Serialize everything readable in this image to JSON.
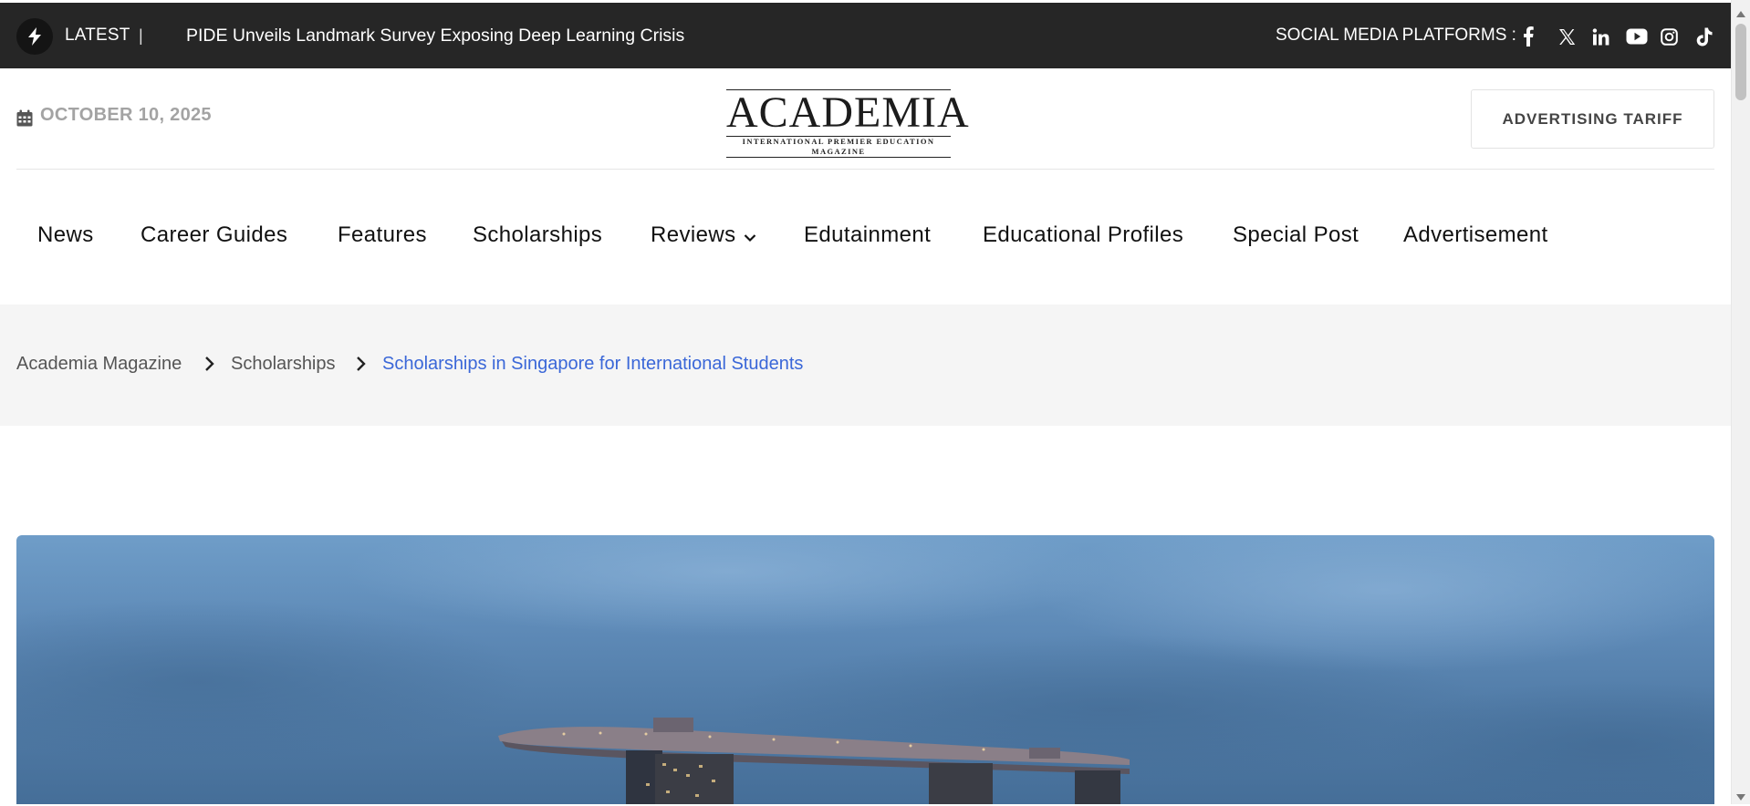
{
  "topbar": {
    "latest_label": "LATEST",
    "separator": "|",
    "headline": "PIDE Unveils Landmark Survey Exposing Deep Learning Crisis",
    "social_label": "SOCIAL MEDIA PLATFORMS :",
    "social_icons": [
      "facebook-icon",
      "x-icon",
      "linkedin-icon",
      "youtube-icon",
      "instagram-icon",
      "tiktok-icon"
    ]
  },
  "header": {
    "date": "OCTOBER 10, 2025",
    "logo_name": "ACADEMIA",
    "logo_tagline": "INTERNATIONAL PREMIER EDUCATION MAGAZINE",
    "advertising_button": "ADVERTISING TARIFF"
  },
  "nav": {
    "items": [
      {
        "label": "News"
      },
      {
        "label": "Career Guides"
      },
      {
        "label": "Features"
      },
      {
        "label": "Scholarships"
      },
      {
        "label": "Reviews"
      },
      {
        "label": "Edutainment"
      },
      {
        "label": "Educational Profiles"
      },
      {
        "label": "Special Post"
      },
      {
        "label": "Advertisement"
      }
    ]
  },
  "breadcrumb": {
    "items": [
      {
        "label": "Academia Magazine"
      },
      {
        "label": "Scholarships"
      },
      {
        "label": "Scholarships in Singapore for International Students"
      }
    ]
  },
  "colors": {
    "topbar_bg": "#262626",
    "breadcrumb_active": "#3a67d8",
    "date_text": "#a3a3a3",
    "breadcrumb_bg": "#f5f5f5"
  }
}
